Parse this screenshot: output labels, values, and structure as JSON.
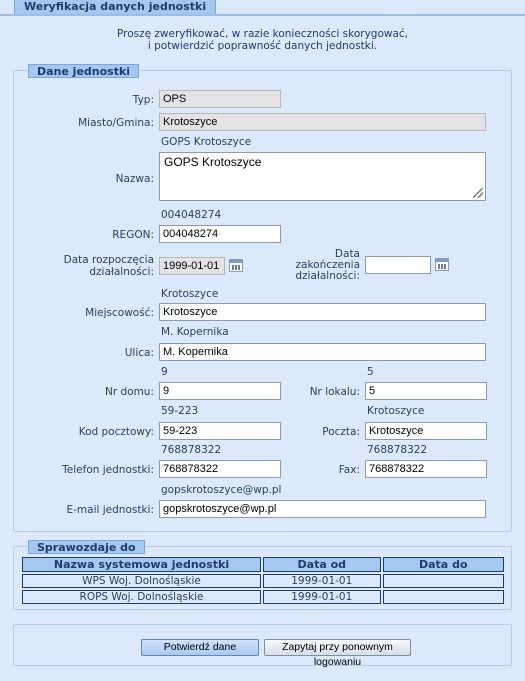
{
  "header": {
    "title": "Weryfikacja danych jednostki"
  },
  "intro": {
    "line1": "Proszę zweryfikować, w razie konieczności skorygować,",
    "line2": "i potwierdzić poprawność danych jednostki."
  },
  "unit": {
    "legend": "Dane jednostki",
    "typ": {
      "label": "Typ:",
      "value": "OPS"
    },
    "miasto": {
      "label": "Miasto/Gmina:",
      "value": "Krotoszyce"
    },
    "nazwa": {
      "label": "Nazwa:",
      "hint": "GOPS Krotoszyce",
      "value": "GOPS Krotoszyce"
    },
    "regon": {
      "label": "REGON:",
      "hint": "004048274",
      "value": "004048274"
    },
    "data_start": {
      "label_line1": "Data rozpoczęcia",
      "label_line2": "działalności:",
      "value": "1999-01-01"
    },
    "data_end": {
      "label_line1": "Data",
      "label_line2": "zakończenia",
      "label_line3": "działalności:",
      "value": ""
    },
    "miejscowosc": {
      "label": "Miejscowość:",
      "hint": "Krotoszyce",
      "value": "Krotoszyce"
    },
    "ulica": {
      "label": "Ulica:",
      "hint": "M. Kopernika",
      "value": "M. Kopernika"
    },
    "nr_domu": {
      "label": "Nr domu:",
      "hint": "9",
      "value": "9"
    },
    "nr_lokalu": {
      "label": "Nr lokalu:",
      "hint": "5",
      "value": "5"
    },
    "kod": {
      "label": "Kod pocztowy:",
      "hint": "59-223",
      "value": "59-223"
    },
    "poczta": {
      "label": "Poczta:",
      "hint": "Krotoszyce",
      "value": "Krotoszyce"
    },
    "telefon": {
      "label": "Telefon jednostki:",
      "hint": "768878322",
      "value": "768878322"
    },
    "fax": {
      "label": "Fax:",
      "hint": "768878322",
      "value": "768878322"
    },
    "email": {
      "label": "E-mail jednostki:",
      "hint": "gopskrotoszyce@wp.pl",
      "value": "gopskrotoszyce@wp.pl"
    }
  },
  "report": {
    "legend": "Sprawozdaje do",
    "columns": [
      "Nazwa systemowa jednostki",
      "Data od",
      "Data do"
    ],
    "rows": [
      [
        "WPS Woj. Dolnośląskie",
        "1999-01-01",
        ""
      ],
      [
        "ROPS Woj. Dolnośląskie",
        "1999-01-01",
        ""
      ]
    ]
  },
  "actions": {
    "confirm": "Potwierdź dane",
    "ask_later": "Zapytaj przy ponownym logowaniu"
  },
  "icons": {
    "calendar": "calendar-icon",
    "resize": "resize-grip-icon"
  }
}
